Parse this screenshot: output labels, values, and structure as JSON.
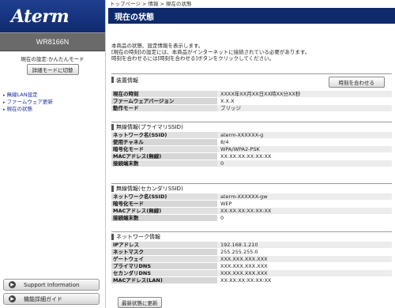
{
  "sidebar": {
    "logo_text": "Aterm",
    "model": "WR8166N",
    "mode_text": "現在の設定:かんたんモード",
    "mode_button": "詳細モードに切替",
    "nav": [
      "無線LAN設定",
      "ファームウェア更新",
      "現在の状態"
    ],
    "support_label": "Support Information",
    "guide_label": "機能詳細ガイド"
  },
  "header": {
    "breadcrumb": "トップページ > 情報 > 現在の状態",
    "title": "現在の状態"
  },
  "intro": [
    "本商品の状態、設定情報を表示します。",
    "[現在の時刻]の設定には、本商品がインターネットに接続されている必要があります。",
    "時刻を合わせるには[時刻を合わせる]ボタンをクリックしてください。"
  ],
  "device": {
    "heading": "装置情報",
    "sync_button": "時刻を合わせる",
    "rows": [
      {
        "k": "現在の時刻",
        "v": "XXXX年XX月XX日XX時XX分XX秒"
      },
      {
        "k": "ファームウェアバージョン",
        "v": "X.X.X"
      },
      {
        "k": "動作モード",
        "v": "ブリッジ"
      }
    ]
  },
  "wireless_primary": {
    "heading": "無線情報(プライマリSSID)",
    "rows": [
      {
        "k": "ネットワーク名(SSID)",
        "v": "aterm-XXXXXX-g"
      },
      {
        "k": "使用チャネル",
        "v": "8/4"
      },
      {
        "k": "暗号化モード",
        "v": "WPA/WPA2-PSK"
      },
      {
        "k": "MACアドレス(無線)",
        "v": "XX:XX:XX:XX:XX:XX"
      },
      {
        "k": "接続端末数",
        "v": "0"
      }
    ]
  },
  "wireless_secondary": {
    "heading": "無線情報(セカンダリSSID)",
    "rows": [
      {
        "k": "ネットワーク名(SSID)",
        "v": "aterm-XXXXXX-gw"
      },
      {
        "k": "暗号化モード",
        "v": "WEP"
      },
      {
        "k": "MACアドレス(無線)",
        "v": "XX:XX:XX:XX:XX:XX"
      },
      {
        "k": "接続端末数",
        "v": "0"
      }
    ]
  },
  "network": {
    "heading": "ネットワーク情報",
    "rows": [
      {
        "k": "IPアドレス",
        "v": "192.168.1.210"
      },
      {
        "k": "ネットマスク",
        "v": "255.255.255.0"
      },
      {
        "k": "ゲートウェイ",
        "v": "XXX.XXX.XXX.XXX"
      },
      {
        "k": "プライマリDNS",
        "v": "XXX.XXX.XXX.XXX"
      },
      {
        "k": "セカンダリDNS",
        "v": "XXX.XXX.XXX.XXX"
      },
      {
        "k": "MACアドレス(LAN)",
        "v": "XX:XX:XX:XX:XX:XX"
      }
    ]
  },
  "refresh_button": "最新状態に更新"
}
